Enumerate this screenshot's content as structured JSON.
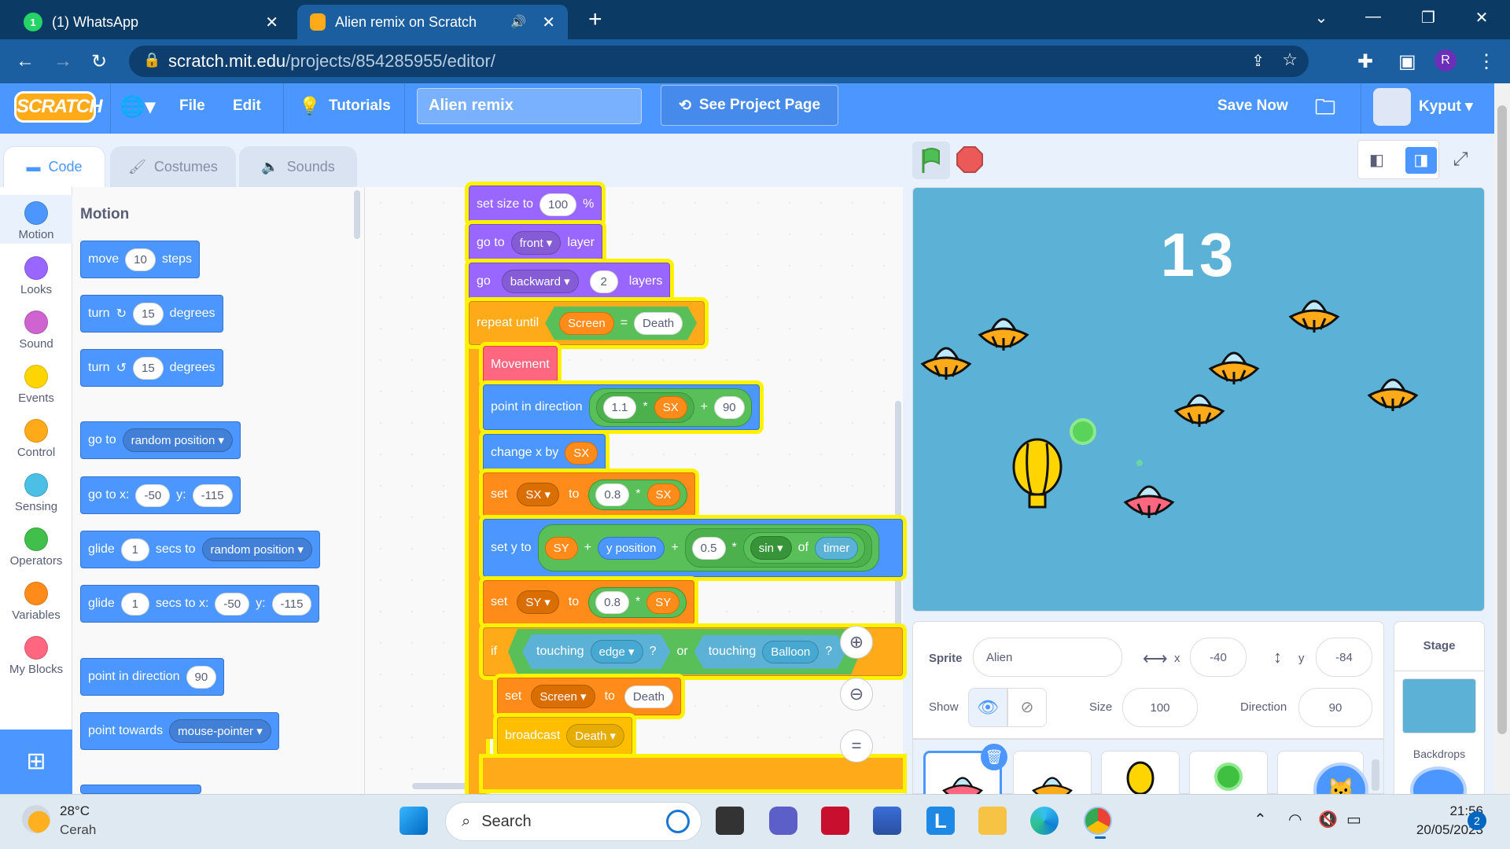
{
  "browser": {
    "tabs": [
      {
        "title": "(1) WhatsApp",
        "badge": "1"
      },
      {
        "title": "Alien remix on Scratch"
      }
    ],
    "url_host": "scratch.mit.edu",
    "url_path": "/projects/854285955/editor/",
    "profile_initial": "R"
  },
  "menubar": {
    "logo": "SCRATCH",
    "file": "File",
    "edit": "Edit",
    "tutorials": "Tutorials",
    "project_title": "Alien remix",
    "see_project": "See Project Page",
    "save_now": "Save Now",
    "user": "Kyput"
  },
  "editor_tabs": {
    "code": "Code",
    "costumes": "Costumes",
    "sounds": "Sounds"
  },
  "categories": [
    {
      "label": "Motion",
      "color": "#4c97ff"
    },
    {
      "label": "Looks",
      "color": "#9966ff"
    },
    {
      "label": "Sound",
      "color": "#cf63cf"
    },
    {
      "label": "Events",
      "color": "#ffd500"
    },
    {
      "label": "Control",
      "color": "#ffab19"
    },
    {
      "label": "Sensing",
      "color": "#4cbfe6"
    },
    {
      "label": "Operators",
      "color": "#40bf4a"
    },
    {
      "label": "Variables",
      "color": "#ff8c1a"
    },
    {
      "label": "My Blocks",
      "color": "#ff6680"
    }
  ],
  "palette": {
    "heading": "Motion",
    "move": {
      "a": "move",
      "v": "10",
      "b": "steps"
    },
    "turn_cw": {
      "a": "turn",
      "v": "15",
      "b": "degrees"
    },
    "turn_ccw": {
      "a": "turn",
      "v": "15",
      "b": "degrees"
    },
    "goto": {
      "a": "go to",
      "dd": "random position"
    },
    "gotoxy": {
      "a": "go to x:",
      "x": "-50",
      "b": "y:",
      "y": "-115"
    },
    "glide_rand": {
      "a": "glide",
      "v": "1",
      "b": "secs to",
      "dd": "random position"
    },
    "glide_xy": {
      "a": "glide",
      "v": "1",
      "b": "secs to x:",
      "x": "-50",
      "c": "y:",
      "y": "-115"
    },
    "point_dir": {
      "a": "point in direction",
      "v": "90"
    },
    "point_towards": {
      "a": "point towards",
      "dd": "mouse-pointer"
    }
  },
  "script": {
    "setsize": {
      "a": "set size to",
      "v": "100",
      "b": "%"
    },
    "goto_layer": {
      "a": "go to",
      "dd": "front",
      "b": "layer"
    },
    "go_layers": {
      "a": "go",
      "dd": "backward",
      "v": "2",
      "b": "layers"
    },
    "repeat": {
      "a": "repeat until",
      "var": "Screen",
      "op": "=",
      "v": "Death"
    },
    "movement": "Movement",
    "point": {
      "a": "point in direction",
      "v1": "1.1",
      "m": "*",
      "var": "SX",
      "p": "+",
      "v2": "90"
    },
    "changex": {
      "a": "change x by",
      "var": "SX"
    },
    "setsx": {
      "a": "set",
      "dd": "SX",
      "b": "to",
      "v": "0.8",
      "m": "*",
      "var": "SX"
    },
    "sety": {
      "a": "set y to",
      "var": "SY",
      "p": "+",
      "rep": "y position",
      "p2": "+",
      "v": "0.5",
      "m": "*",
      "fn": "sin",
      "of": "of",
      "timer": "timer"
    },
    "setsy": {
      "a": "set",
      "dd": "SY",
      "b": "to",
      "v": "0.8",
      "m": "*",
      "var": "SY"
    },
    "if": {
      "a": "if",
      "t1": "touching",
      "dd1": "edge",
      "q": "?",
      "or": "or",
      "t2": "touching",
      "dd2": "Balloon",
      "q2": "?"
    },
    "setscreen": {
      "a": "set",
      "dd": "Screen",
      "b": "to",
      "v": "Death"
    },
    "broadcast": {
      "a": "broadcast",
      "dd": "Death"
    }
  },
  "stage": {
    "score": "13"
  },
  "sprite_info": {
    "sprite_label": "Sprite",
    "sprite_name": "Alien",
    "x_label": "x",
    "x": "-40",
    "y_label": "y",
    "y": "-84",
    "show_label": "Show",
    "size_label": "Size",
    "size": "100",
    "direction_label": "Direction",
    "direction": "90"
  },
  "stage_pane": {
    "title": "Stage",
    "backdrops": "Backdrops"
  },
  "taskbar": {
    "temp": "28°C",
    "weather": "Cerah",
    "search": "Search",
    "time": "21:56",
    "date": "20/05/2023",
    "notifications": "2"
  }
}
